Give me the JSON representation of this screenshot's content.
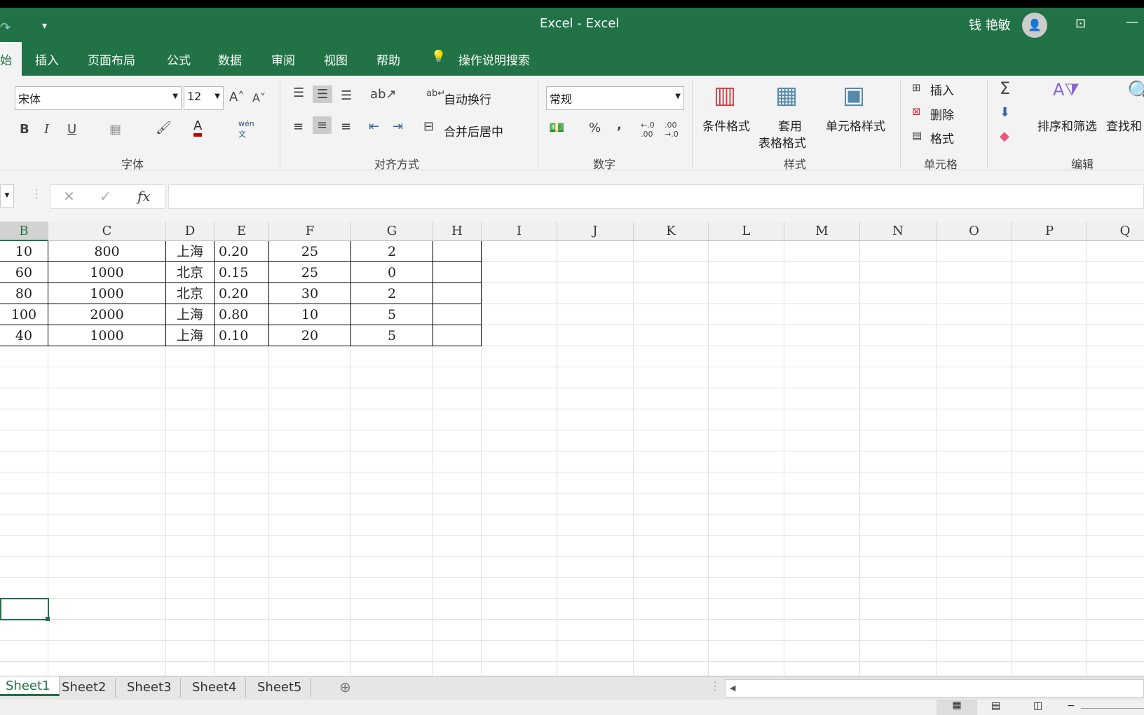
{
  "title": {
    "app_title": "Excel  -  Excel",
    "user": "钱 艳敏"
  },
  "tabs": [
    "始",
    "插入",
    "页面布局",
    "公式",
    "数据",
    "审阅",
    "视图",
    "帮助"
  ],
  "tell_me": "操作说明搜索",
  "font": {
    "name": "宋体",
    "size": "12",
    "group": "字体",
    "bold": "B",
    "italic": "I",
    "underline": "U",
    "phonetic": "wén"
  },
  "align": {
    "wrap": "自动换行",
    "merge": "合并后居中",
    "group": "对齐方式"
  },
  "number": {
    "format": "常规",
    "percent": "%",
    "comma": ",",
    "inc": "←.0 .00",
    "dec": ".00 →.0",
    "group": "数字"
  },
  "styles": {
    "cond": "条件格式",
    "table1": "套用",
    "table2": "表格格式",
    "cell": "单元格样式",
    "group": "样式"
  },
  "cells": {
    "insert": "插入",
    "delete": "删除",
    "format": "格式",
    "group": "单元格"
  },
  "edit": {
    "sort": "排序和筛选",
    "find": "查找和",
    "group": "编辑"
  },
  "formula": {
    "fx": "fx",
    "value": ""
  },
  "columns": [
    "B",
    "C",
    "D",
    "E",
    "F",
    "G",
    "H",
    "I",
    "J",
    "K",
    "L",
    "M",
    "N",
    "O",
    "P",
    "Q"
  ],
  "rows": [
    [
      "10",
      "800",
      "上海",
      "0.20",
      "25",
      "2"
    ],
    [
      "60",
      "1000",
      "北京",
      "0.15",
      "25",
      "0"
    ],
    [
      "80",
      "1000",
      "北京",
      "0.20",
      "30",
      "2"
    ],
    [
      "100",
      "2000",
      "上海",
      "0.80",
      "10",
      "5"
    ],
    [
      "40",
      "1000",
      "上海",
      "0.10",
      "20",
      "5"
    ]
  ],
  "sheets": [
    "Sheet1",
    "Sheet2",
    "Sheet3",
    "Sheet4",
    "Sheet5"
  ],
  "active_sheet": "Sheet1",
  "colors": {
    "brand": "#217346"
  }
}
